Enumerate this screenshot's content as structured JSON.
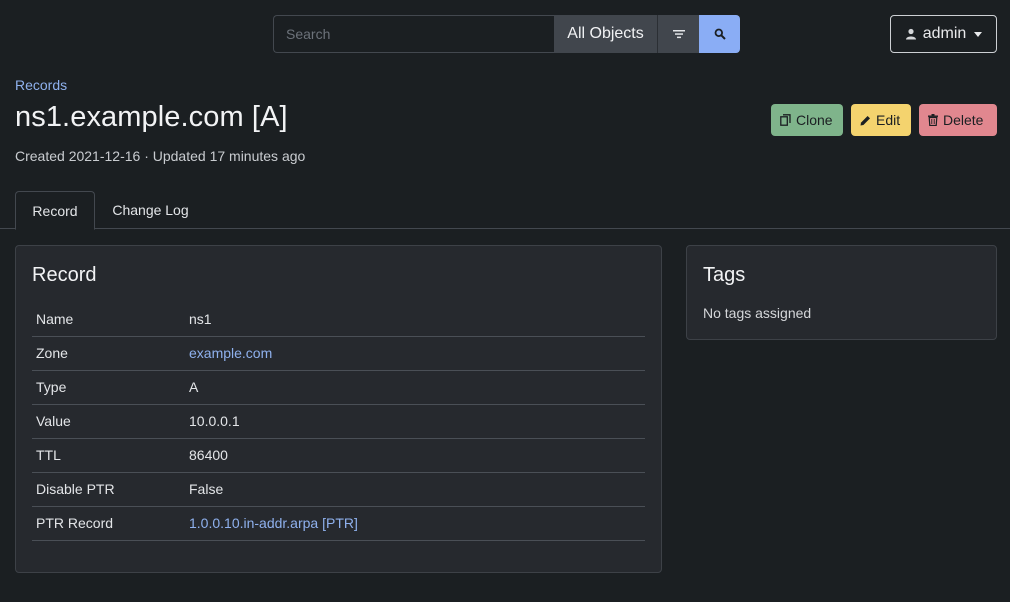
{
  "search": {
    "placeholder": "Search",
    "scope": "All Objects"
  },
  "user": {
    "name": "admin"
  },
  "breadcrumb": "Records",
  "page": {
    "title": "ns1.example.com [A]",
    "meta": "Created 2021-12-16 · Updated 17 minutes ago"
  },
  "actions": {
    "clone": "Clone",
    "edit": "Edit",
    "delete": "Delete"
  },
  "tabs": [
    {
      "label": "Record",
      "active": true
    },
    {
      "label": "Change Log",
      "active": false
    }
  ],
  "record_card": {
    "title": "Record",
    "rows": [
      {
        "key": "Name",
        "value": "ns1",
        "link": false
      },
      {
        "key": "Zone",
        "value": "example.com",
        "link": true
      },
      {
        "key": "Type",
        "value": "A",
        "link": false
      },
      {
        "key": "Value",
        "value": "10.0.0.1",
        "link": false
      },
      {
        "key": "TTL",
        "value": "86400",
        "link": false
      },
      {
        "key": "Disable PTR",
        "value": "False",
        "link": false
      },
      {
        "key": "PTR Record",
        "value": "1.0.0.10.in-addr.arpa [PTR]",
        "link": true
      }
    ]
  },
  "tags_card": {
    "title": "Tags",
    "empty": "No tags assigned"
  },
  "colors": {
    "accent": "#8aadf5",
    "clone": "#7fb48b",
    "edit": "#f4d36e",
    "delete": "#e1878f",
    "background": "#1b1f22"
  }
}
